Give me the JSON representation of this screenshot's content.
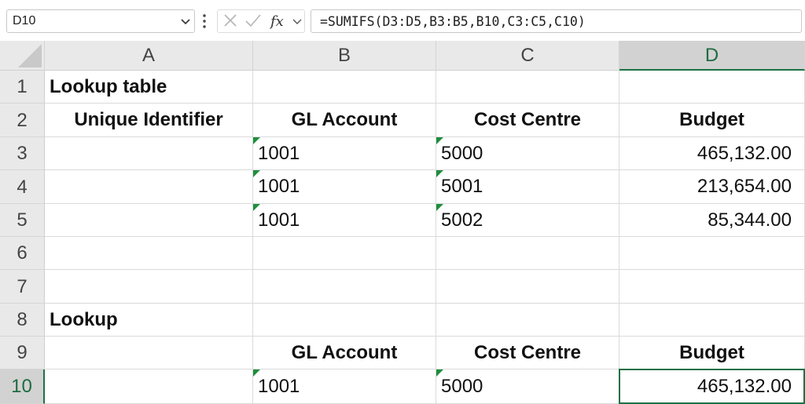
{
  "name_box": {
    "value": "D10"
  },
  "formula_bar": {
    "formula": "=SUMIFS(D3:D5,B3:B5,B10,C3:C5,C10)"
  },
  "icons": {
    "cancel": "x-icon",
    "enter": "check-icon",
    "function": "fx-icon"
  },
  "colors": {
    "selection": "#1e7145",
    "error_triangle": "#1e8e3e",
    "header_bg": "#e9e9e9"
  },
  "columns": [
    "A",
    "B",
    "C",
    "D"
  ],
  "rows": [
    "1",
    "2",
    "3",
    "4",
    "5",
    "6",
    "7",
    "8",
    "9",
    "10"
  ],
  "selected_cell": "D10",
  "cells": {
    "A1": "Lookup table",
    "A2": "Unique Identifier",
    "B2": "GL Account",
    "C2": "Cost Centre",
    "D2": "Budget",
    "B3": "1001",
    "C3": "5000",
    "D3": "465,132.00",
    "B4": "1001",
    "C4": "5001",
    "D4": "213,654.00",
    "B5": "1001",
    "C5": "5002",
    "D5": "85,344.00",
    "A8": "Lookup",
    "B9": "GL Account",
    "C9": "Cost Centre",
    "D9": "Budget",
    "B10": "1001",
    "C10": "5000",
    "D10": "465,132.00"
  }
}
